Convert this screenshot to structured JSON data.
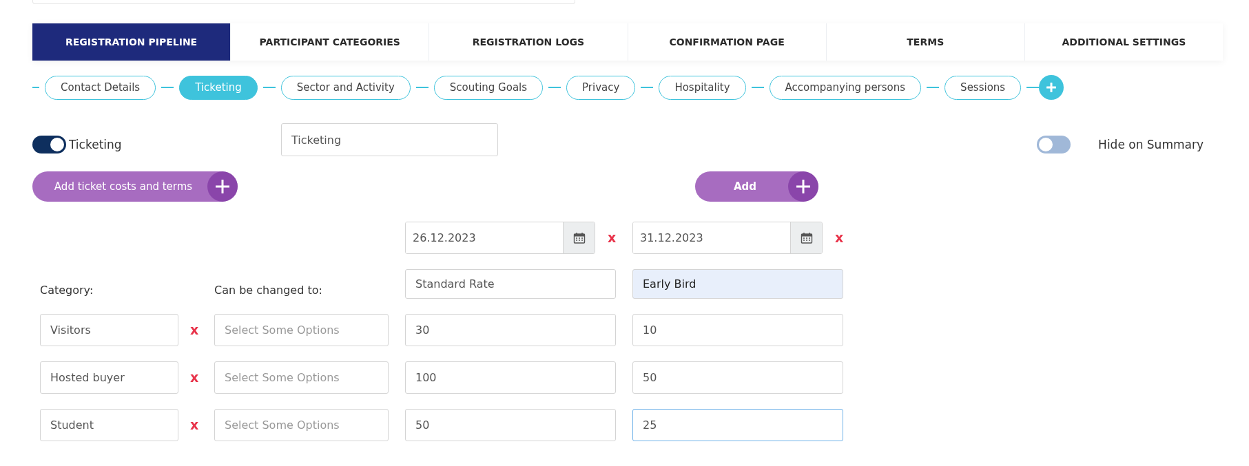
{
  "tabs": [
    {
      "label": "REGISTRATION PIPELINE",
      "selected": true
    },
    {
      "label": "PARTICIPANT CATEGORIES",
      "selected": false
    },
    {
      "label": "REGISTRATION LOGS",
      "selected": false
    },
    {
      "label": "CONFIRMATION PAGE",
      "selected": false
    },
    {
      "label": "TERMS",
      "selected": false
    },
    {
      "label": "ADDITIONAL SETTINGS",
      "selected": false
    }
  ],
  "steps": [
    {
      "label": "Contact Details",
      "selected": false
    },
    {
      "label": "Ticketing",
      "selected": true
    },
    {
      "label": "Sector and Activity",
      "selected": false
    },
    {
      "label": "Scouting Goals",
      "selected": false
    },
    {
      "label": "Privacy",
      "selected": false
    },
    {
      "label": "Hospitality",
      "selected": false
    },
    {
      "label": "Accompanying persons",
      "selected": false
    },
    {
      "label": "Sessions",
      "selected": false
    }
  ],
  "enabled_toggle": {
    "label": "Ticketing",
    "on": true
  },
  "title_field": {
    "value": "Ticketing"
  },
  "hide_on_summary": {
    "label": "Hide on Summary",
    "on": false
  },
  "add_costs_button": {
    "label": "Add ticket costs and terms"
  },
  "add_button": {
    "label": "Add"
  },
  "rate_columns": [
    {
      "date": "26.12.2023",
      "remove": "x",
      "name": "Standard Rate",
      "highlighted": false
    },
    {
      "date": "31.12.2023",
      "remove": "x",
      "name": "Early Bird",
      "highlighted": true
    }
  ],
  "category_label": "Category:",
  "changed_to_label": "Can be changed to:",
  "rows": [
    {
      "category": "Visitors",
      "remove": "x",
      "select_placeholder": "Select Some Options",
      "prices": [
        {
          "value": "30",
          "focused": false
        },
        {
          "value": "10",
          "focused": false
        }
      ]
    },
    {
      "category": "Hosted buyer",
      "remove": "x",
      "select_placeholder": "Select Some Options",
      "prices": [
        {
          "value": "100",
          "focused": false
        },
        {
          "value": "50",
          "focused": false
        }
      ]
    },
    {
      "category": "Student",
      "remove": "x",
      "select_placeholder": "Select Some Options",
      "prices": [
        {
          "value": "50",
          "focused": false
        },
        {
          "value": "25",
          "focused": true
        }
      ]
    }
  ]
}
